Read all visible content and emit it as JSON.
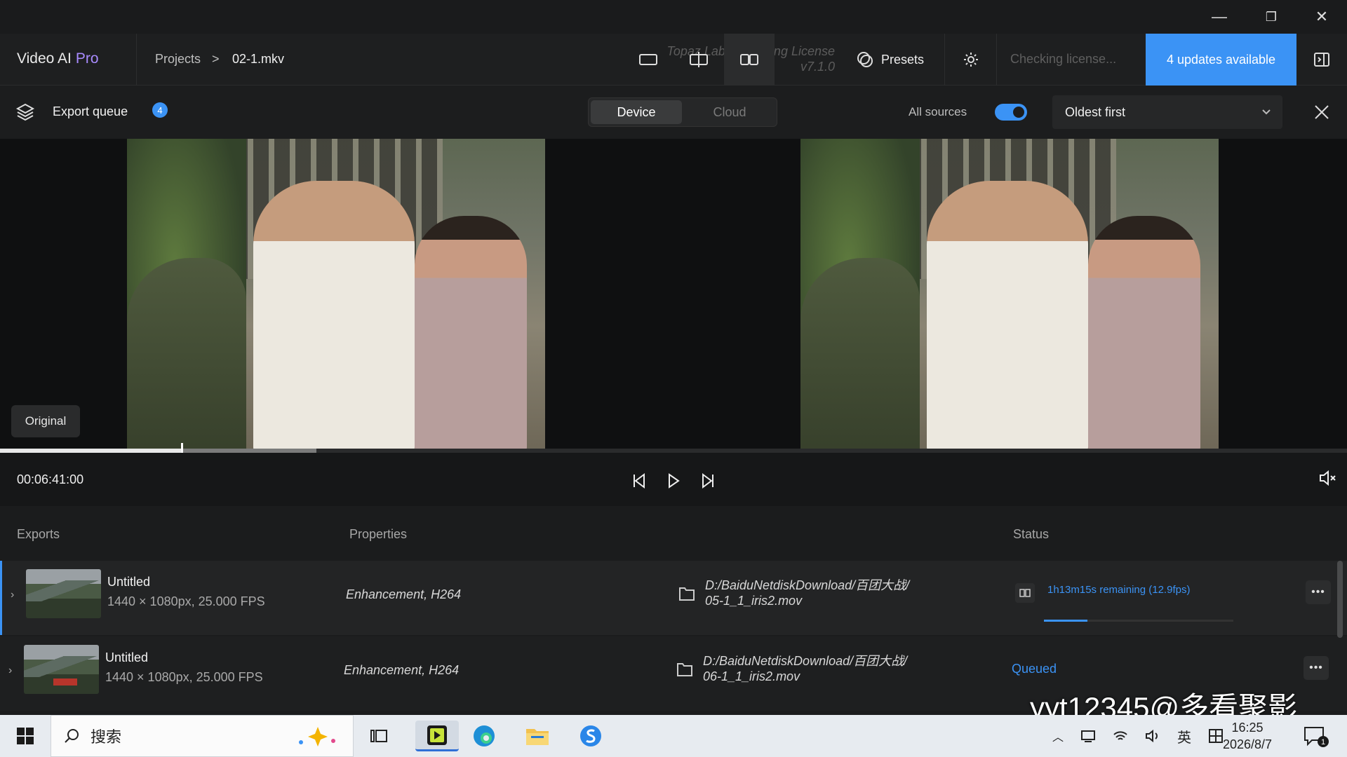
{
  "window": {
    "minimize": "—",
    "restore": "❐",
    "close": "✕"
  },
  "header": {
    "brand_name": "Video AI",
    "brand_tier": "Pro",
    "crumb_projects": "Projects",
    "crumb_sep": ">",
    "crumb_file": "02-1.mkv",
    "license_line1": "Topaz Labs - Floating License",
    "license_line2": "v7.1.0",
    "presets_label": "Presets",
    "checking_label": "Checking license...",
    "updates_label": "4 updates available"
  },
  "queue": {
    "title": "Export queue",
    "badge_count": "4",
    "seg_device": "Device",
    "seg_cloud": "Cloud",
    "all_sources_label": "All sources",
    "all_sources_on": true,
    "sort_value": "Oldest first"
  },
  "preview": {
    "original_label": "Original",
    "timecode": "00:06:41:00",
    "progress_fraction": 0.135,
    "buffered_fraction": 0.235
  },
  "exports": {
    "col_exports": "Exports",
    "col_properties": "Properties",
    "col_status": "Status",
    "rows": [
      {
        "title": "Untitled",
        "meta": "1440 × 1080px, 25.000 FPS",
        "properties": "Enhancement, H264",
        "path_line1": "D:/BaiduNetdiskDownload/百团大战/",
        "path_line2": "05-1_1_iris2.mov",
        "status": "1h13m15s remaining (12.9fps)",
        "status_progress": 0.23
      },
      {
        "title": "Untitled",
        "meta": "1440 × 1080px, 25.000 FPS",
        "properties": "Enhancement, H264",
        "path_line1": "D:/BaiduNetdiskDownload/百团大战/",
        "path_line2": "06-1_1_iris2.mov",
        "status": "Queued"
      }
    ]
  },
  "watermark": "yyt12345@多看聚影",
  "taskbar": {
    "search_placeholder": "搜索",
    "ime_label": "英",
    "clock_time": "16:25",
    "clock_date": "2026/8/7",
    "notif_count": "1"
  },
  "colors": {
    "accent": "#3b93f5",
    "pro": "#a98bff"
  }
}
